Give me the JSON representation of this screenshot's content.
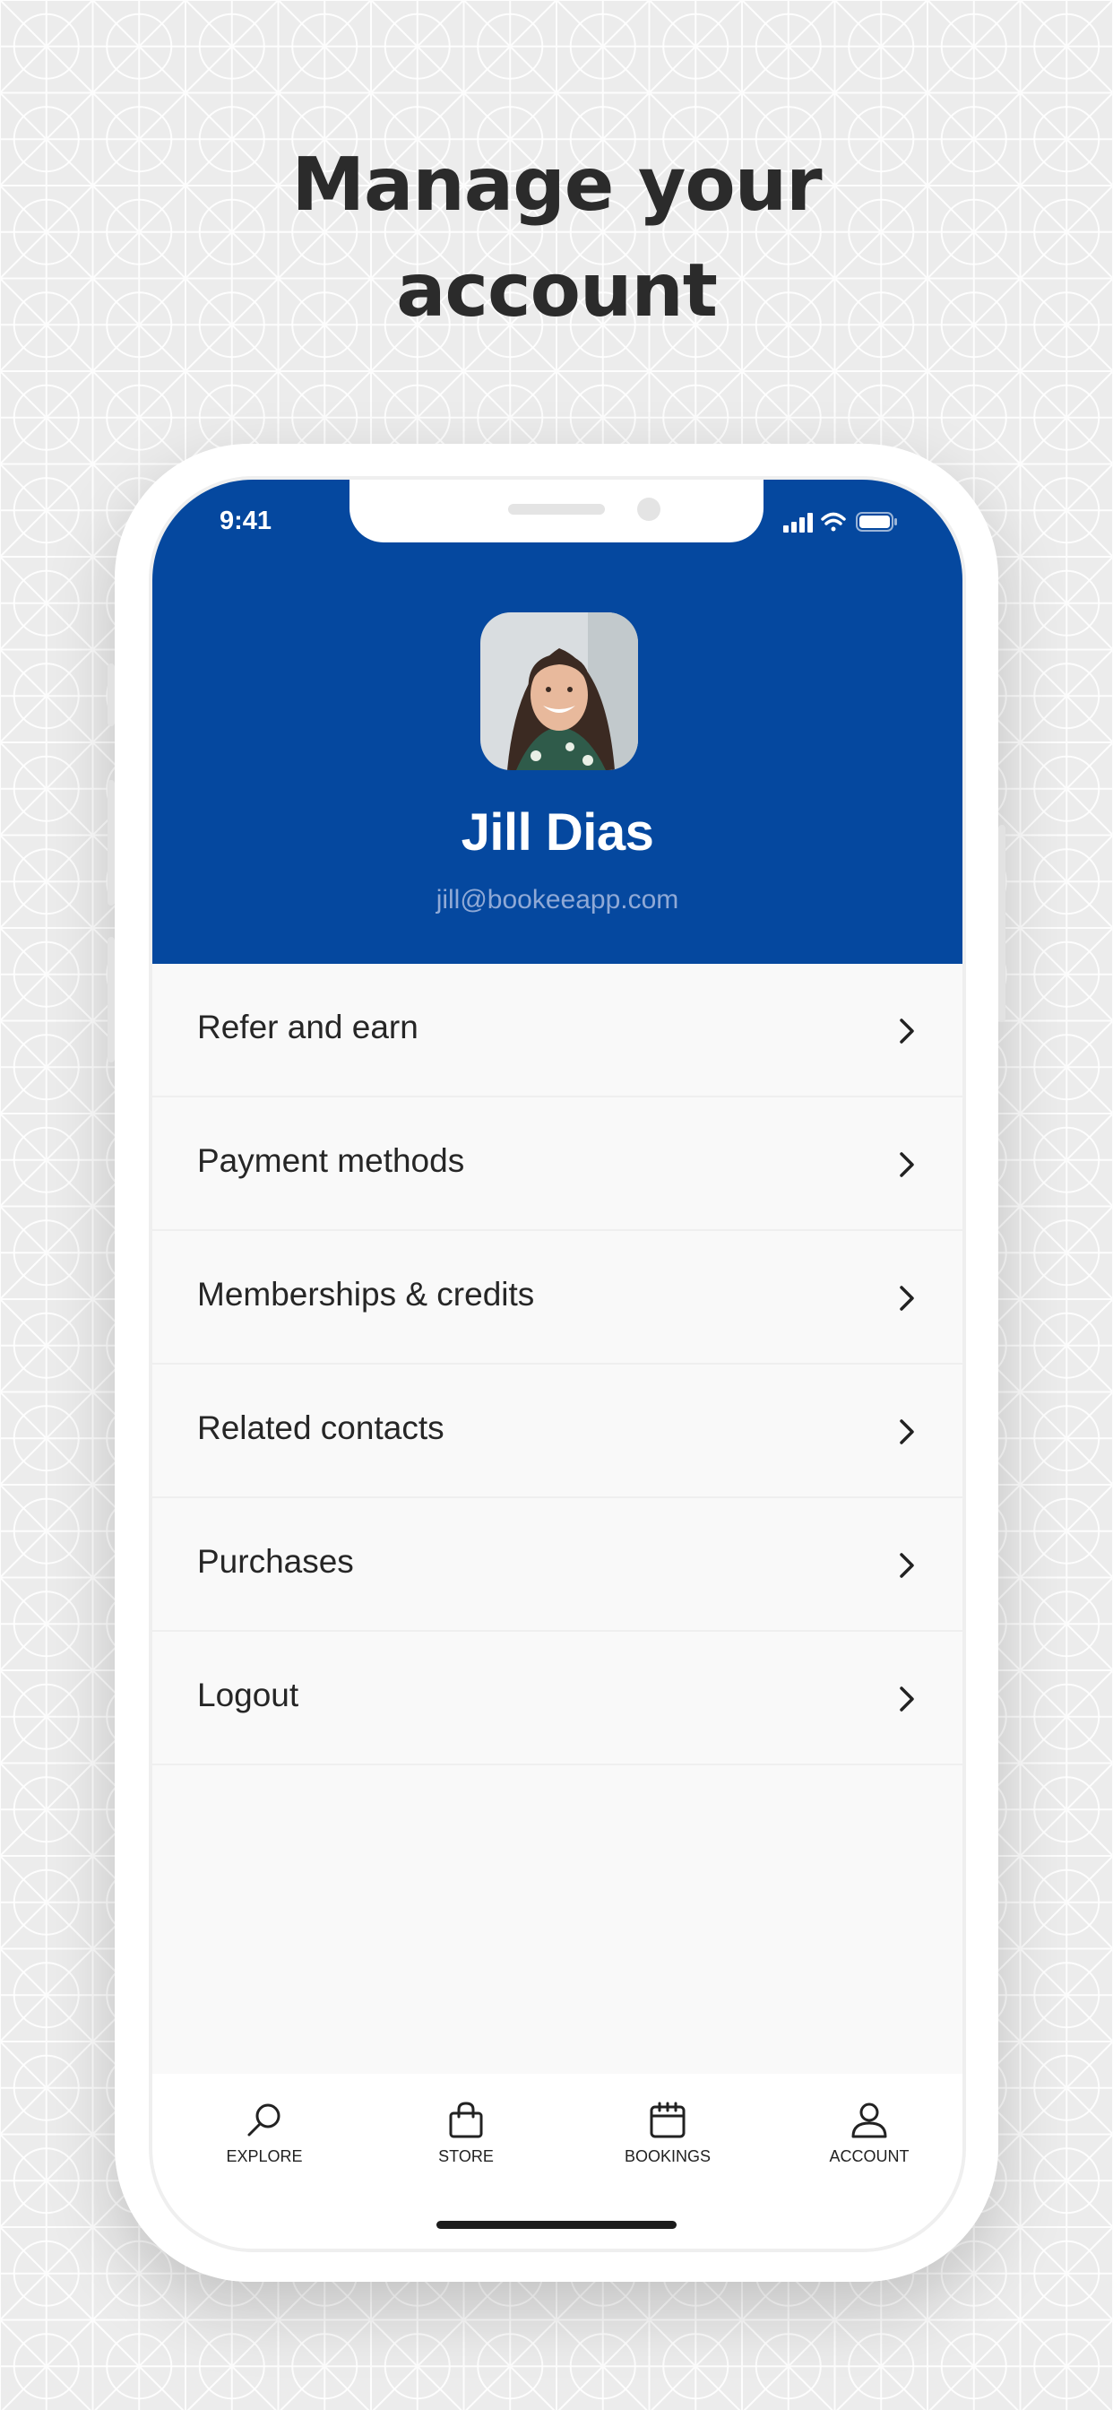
{
  "headline": {
    "line1": "Manage your",
    "line2": "account"
  },
  "status_bar": {
    "time": "9:41"
  },
  "profile": {
    "name": "Jill Dias",
    "email": "jill@bookeeapp.com"
  },
  "menu": {
    "items": [
      {
        "label": "Refer and earn"
      },
      {
        "label": "Payment methods"
      },
      {
        "label": "Memberships & credits"
      },
      {
        "label": "Related contacts"
      },
      {
        "label": "Purchases"
      },
      {
        "label": "Logout"
      }
    ]
  },
  "tabs": [
    {
      "label": "EXPLORE",
      "icon": "search-icon"
    },
    {
      "label": "STORE",
      "icon": "shopping-bag-icon"
    },
    {
      "label": "BOOKINGS",
      "icon": "calendar-icon"
    },
    {
      "label": "ACCOUNT",
      "icon": "user-icon"
    }
  ],
  "colors": {
    "header_blue": "#05489f",
    "background": "#ececec",
    "text_dark": "#262626",
    "email_text": "#8fa9d6"
  }
}
